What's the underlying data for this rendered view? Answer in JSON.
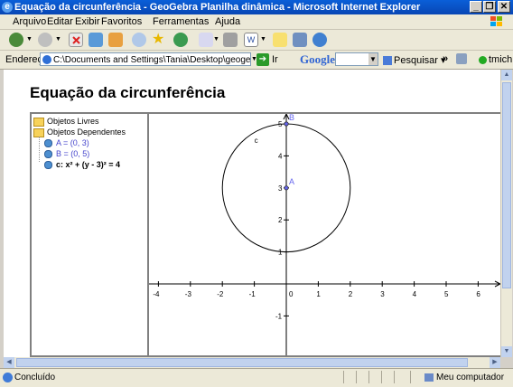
{
  "window": {
    "title": "Equação da circunferência - GeoGebra Planilha dinâmica - Microsoft Internet Explorer",
    "minimize": "_",
    "maximize": "❐",
    "close": "✕"
  },
  "menu": [
    "Arquivo",
    "Editar",
    "Exibir",
    "Favoritos",
    "Ferramentas",
    "Ajuda"
  ],
  "address": {
    "label": "Endereço",
    "value": "C:\\Documents and Settings\\Tania\\Desktop\\geogebra\\eq_circu",
    "go_label": "Ir"
  },
  "google": {
    "logo": "Google",
    "search_label": "Pesquisar",
    "user": "tmich"
  },
  "page": {
    "title": "Equação da circunferência"
  },
  "algebra": {
    "free_label": "Objetos Livres",
    "dependent_label": "Objetos Dependentes",
    "items": [
      {
        "text": "A = (0, 3)",
        "color": "#4444cc"
      },
      {
        "text": "B = (0, 5)",
        "color": "#4444cc"
      },
      {
        "text": "c: x² + (y - 3)² = 4",
        "color": "#000000"
      }
    ]
  },
  "graph": {
    "x_ticks": [
      "-4",
      "-3",
      "-2",
      "-1",
      "0",
      "1",
      "2",
      "3",
      "4",
      "5",
      "6"
    ],
    "y_ticks": [
      "-1",
      "1",
      "2",
      "3",
      "4",
      "5",
      "6"
    ],
    "point_A": {
      "label": "A",
      "x": 0,
      "y": 3
    },
    "point_B": {
      "label": "B",
      "x": 0,
      "y": 5
    },
    "circle": {
      "label": "c",
      "center_x": 0,
      "center_y": 3,
      "radius": 2
    }
  },
  "status": {
    "text": "Concluído",
    "zone": "Meu computador"
  }
}
